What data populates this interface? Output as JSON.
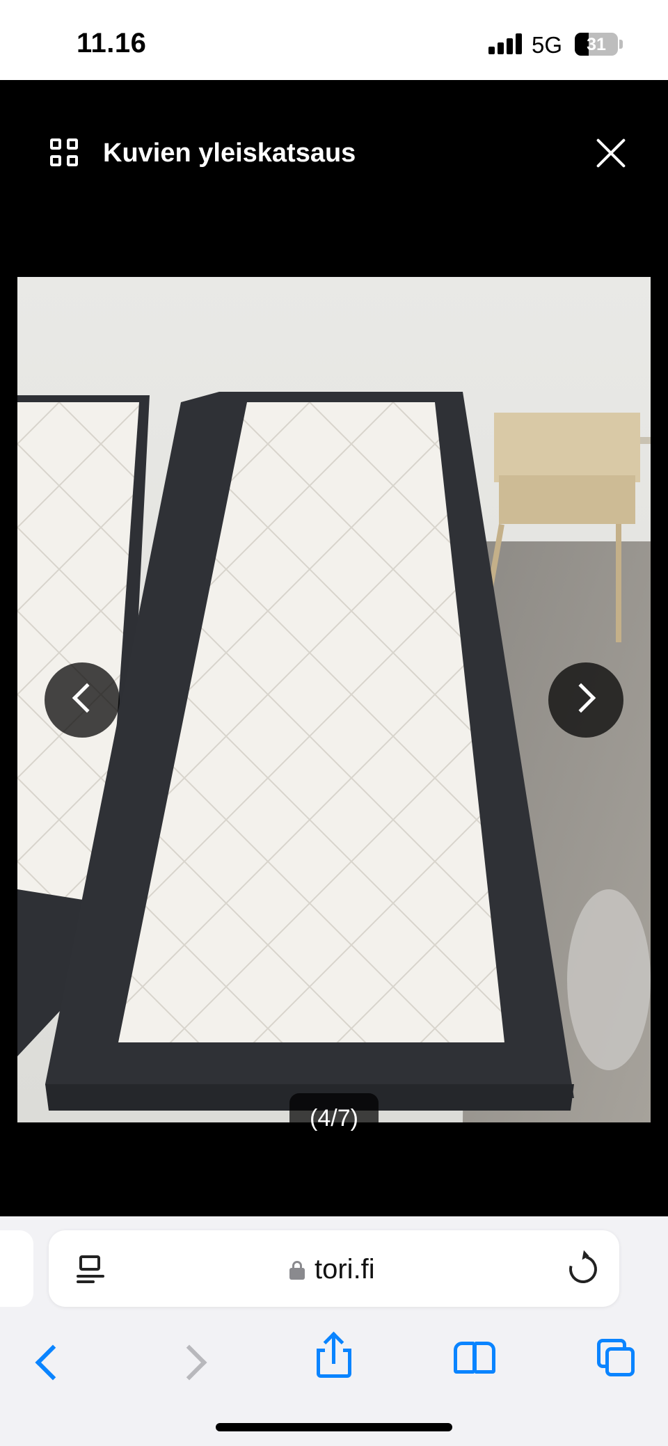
{
  "status_bar": {
    "time": "11.16",
    "network": "5G",
    "battery": "31",
    "signal_icon": "cellular-signal-icon"
  },
  "viewer": {
    "title": "Kuvien yleiskatsaus",
    "grid_icon": "grid-icon",
    "close_icon": "close-icon",
    "counter": "(4/7)",
    "prev_icon": "chevron-left-icon",
    "next_icon": "chevron-right-icon"
  },
  "browser": {
    "url": "tori.fi",
    "lock_icon": "lock-icon",
    "reader_icon": "reader-mode-icon",
    "reload_icon": "reload-icon",
    "toolbar": [
      "back-icon",
      "forward-icon",
      "share-icon",
      "bookmarks-icon",
      "tabs-icon"
    ]
  },
  "colors": {
    "accent": "#0a84ff",
    "viewer_bg": "#000000",
    "toolbar_bg": "#f2f2f5"
  }
}
